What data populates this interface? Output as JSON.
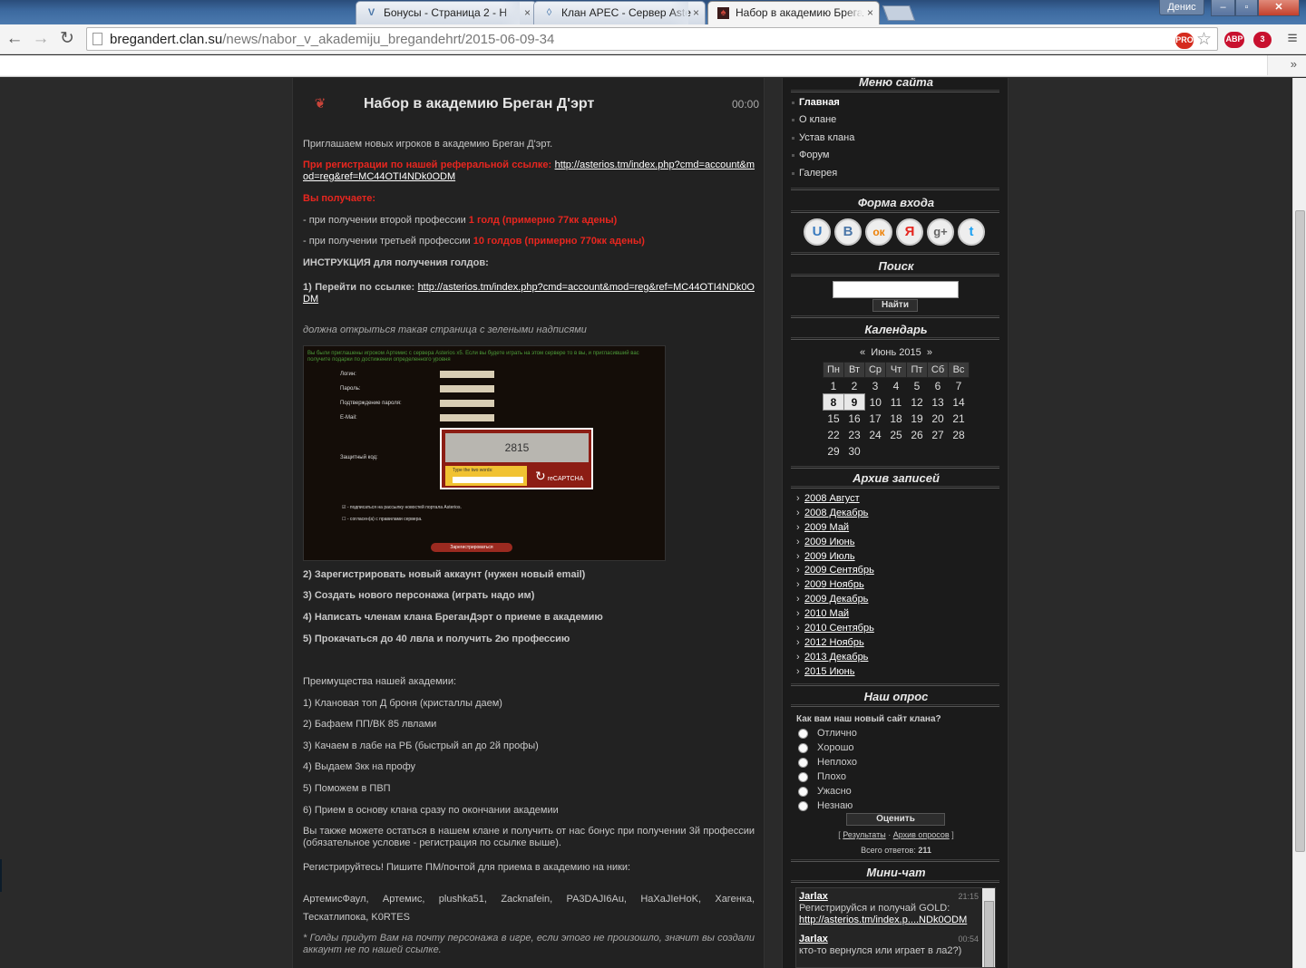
{
  "browser": {
    "tabs": [
      {
        "title": "Бонусы - Страница 2 - Н",
        "icon": "vk-icon"
      },
      {
        "title": "Клан APEC - Сервер Aste",
        "icon": "shield-icon"
      },
      {
        "title": "Набор в академию Брега",
        "icon": "clan-icon"
      }
    ],
    "profile_name": "Денис",
    "url_host": "bregandert.clan.su",
    "url_path": "/news/nabor_v_akademiju_bregandehrt/2015-06-09-34",
    "ext_badges": {
      "abp": "ABP",
      "abp_count": "3",
      "lock_count": "3",
      "pro": "PRO"
    },
    "bookmark_chevron": "»"
  },
  "colors": {
    "accent_red": "#e8261f",
    "page_bg": "#2a2a2a",
    "content_bg": "#222222"
  },
  "post": {
    "title": "Набор в академию Бреган Д'эрт",
    "time": "00:00",
    "intro": "Приглашаем новых игроков в академию Бреган Д'эрт.",
    "ref_label": "При регистрации по нашей реферальной ссылке:",
    "ref_link": "http://asterios.tm/index.php?cmd=account&mod=reg&ref=MC44OTI4NDk0ODM",
    "you_get": "Вы получаете:",
    "bonus2_text": "- при получении второй профессии ",
    "bonus2_red": "1 голд (примерно 77кк адены)",
    "bonus3_text": "- при получении третьей профессии ",
    "bonus3_red": "10 голдов (примерно 770кк адены)",
    "instr_head": "ИНСТРУКЦИЯ для получения голдов:",
    "step1_text": "1) Перейти по ссылке: ",
    "step1_link": "http://asterios.tm/index.php?cmd=account&mod=reg&ref=MC44OTI4NDk0ODM",
    "should_open": "должна открыться такая страница с зелеными надписями",
    "screenshot": {
      "banner": "Вы были приглашены игроком Артемис с сервера Asterios x5. Если вы будете играть на этом сервере то в вы, и пригласивший вас получите подарки по достижении определенного уровня",
      "fields": [
        "Логин:",
        "Пароль:",
        "Подтверждение пароля:",
        "E-Mail:"
      ],
      "captcha_label": "Защитный код:",
      "captcha_word": "2815",
      "captcha_hint": "Type the two words:",
      "recaptcha": "reCAPTCHA",
      "check1": "- подписаться на рассылку новостей портала Asterios.",
      "check2": "- согласен(а) с правилами сервера.",
      "submit": "Зарегистрироваться"
    },
    "step2": "2) Зарегистрировать новый аккаунт (нужен новый email)",
    "step3": "3) Создать нового персонажа (играть надо им)",
    "step4": "4) Написать членам клана БреганДэрт о приеме в академию",
    "step5": "5) Прокачаться до 40 лвла и получить 2ю профессию",
    "adv_head": "Преимущества нашей академии:",
    "adv": [
      "1) Клановая топ Д броня (кристаллы даем)",
      "2) Бафаем ПП/ВК 85 лвлами",
      "3) Качаем в лабе на РБ (быстрый ап до 2й профы)",
      "4) Выдаем 3кк на профу",
      "5) Поможем в ПВП",
      "6) Прием в основу клана сразу по окончании академии"
    ],
    "also": "Вы также можете остаться в нашем клане и получить от нас бонус при получении 3й профессии (обязательное условие - регистрация по ссылке выше).",
    "register": "Регистрируйтесь! Пишите ПМ/почтой для приема в академию на ники:",
    "nicks": "АртемисФаул, Артемис, plushka51, Zacknafein, PA3DAJI6Au, HaXaJIeHoK, Хагенка, Тескатлипока, K0RTES",
    "footnote": "* Голды придут Вам на почту персонажа в игре, если этого не произошло, значит вы создали аккаунт не по нашей ссылке."
  },
  "sidebar": {
    "menu_title": "Меню сайта",
    "menu": [
      "Главная",
      "О клане",
      "Устав клана",
      "Форум",
      "Галерея"
    ],
    "login_title": "Форма входа",
    "social": [
      {
        "icon": "ucoz-icon",
        "glyph": "U",
        "color": "#3b7bbf"
      },
      {
        "icon": "vk-icon",
        "glyph": "В",
        "color": "#4a76a8"
      },
      {
        "icon": "odnoklassniki-icon",
        "glyph": "ок",
        "color": "#ee8208"
      },
      {
        "icon": "yandex-icon",
        "glyph": "Я",
        "color": "#e52620"
      },
      {
        "icon": "google-plus-icon",
        "glyph": "g+",
        "color": "#666666"
      },
      {
        "icon": "twitter-icon",
        "glyph": "t",
        "color": "#1da1f2"
      }
    ],
    "search_title": "Поиск",
    "search_button": "Найти",
    "calendar_title": "Календарь",
    "calendar_prev": "«",
    "calendar_next": "»",
    "calendar_month": "Июнь 2015",
    "weekdays": [
      "Пн",
      "Вт",
      "Ср",
      "Чт",
      "Пт",
      "Сб",
      "Вс"
    ],
    "weeks": [
      [
        "1",
        "2",
        "3",
        "4",
        "5",
        "6",
        "7"
      ],
      [
        "8",
        "9",
        "10",
        "11",
        "12",
        "13",
        "14"
      ],
      [
        "15",
        "16",
        "17",
        "18",
        "19",
        "20",
        "21"
      ],
      [
        "22",
        "23",
        "24",
        "25",
        "26",
        "27",
        "28"
      ],
      [
        "29",
        "30",
        "",
        "",
        "",
        "",
        ""
      ]
    ],
    "highlighted_days": [
      "8",
      "9"
    ],
    "archive_title": "Архив записей",
    "archive": [
      "2008 Август",
      "2008 Декабрь",
      "2009 Май",
      "2009 Июнь",
      "2009 Июль",
      "2009 Сентябрь",
      "2009 Ноябрь",
      "2009 Декабрь",
      "2010 Май",
      "2010 Сентябрь",
      "2012 Ноябрь",
      "2013 Декабрь",
      "2015 Июнь"
    ],
    "poll_title": "Наш опрос",
    "poll_question": "Как вам наш новый сайт клана?",
    "poll_options": [
      "Отлично",
      "Хорошо",
      "Неплохо",
      "Плохо",
      "Ужасно",
      "Незнаю"
    ],
    "poll_button": "Оценить",
    "poll_results": "Результаты",
    "poll_archive": "Архив опросов",
    "poll_total_label": "Всего ответов: ",
    "poll_total": "211",
    "chat_title": "Мини-чат",
    "chat": [
      {
        "name": "Jarlax",
        "time": "21:15",
        "text": "Регистрируйся и получай GOLD:",
        "link": "http://asterios.tm/index.p....NDk0ODM"
      },
      {
        "name": "Jarlax",
        "time": "00:54",
        "text": "кто-то вернулся или играет в ла2?)"
      }
    ]
  }
}
